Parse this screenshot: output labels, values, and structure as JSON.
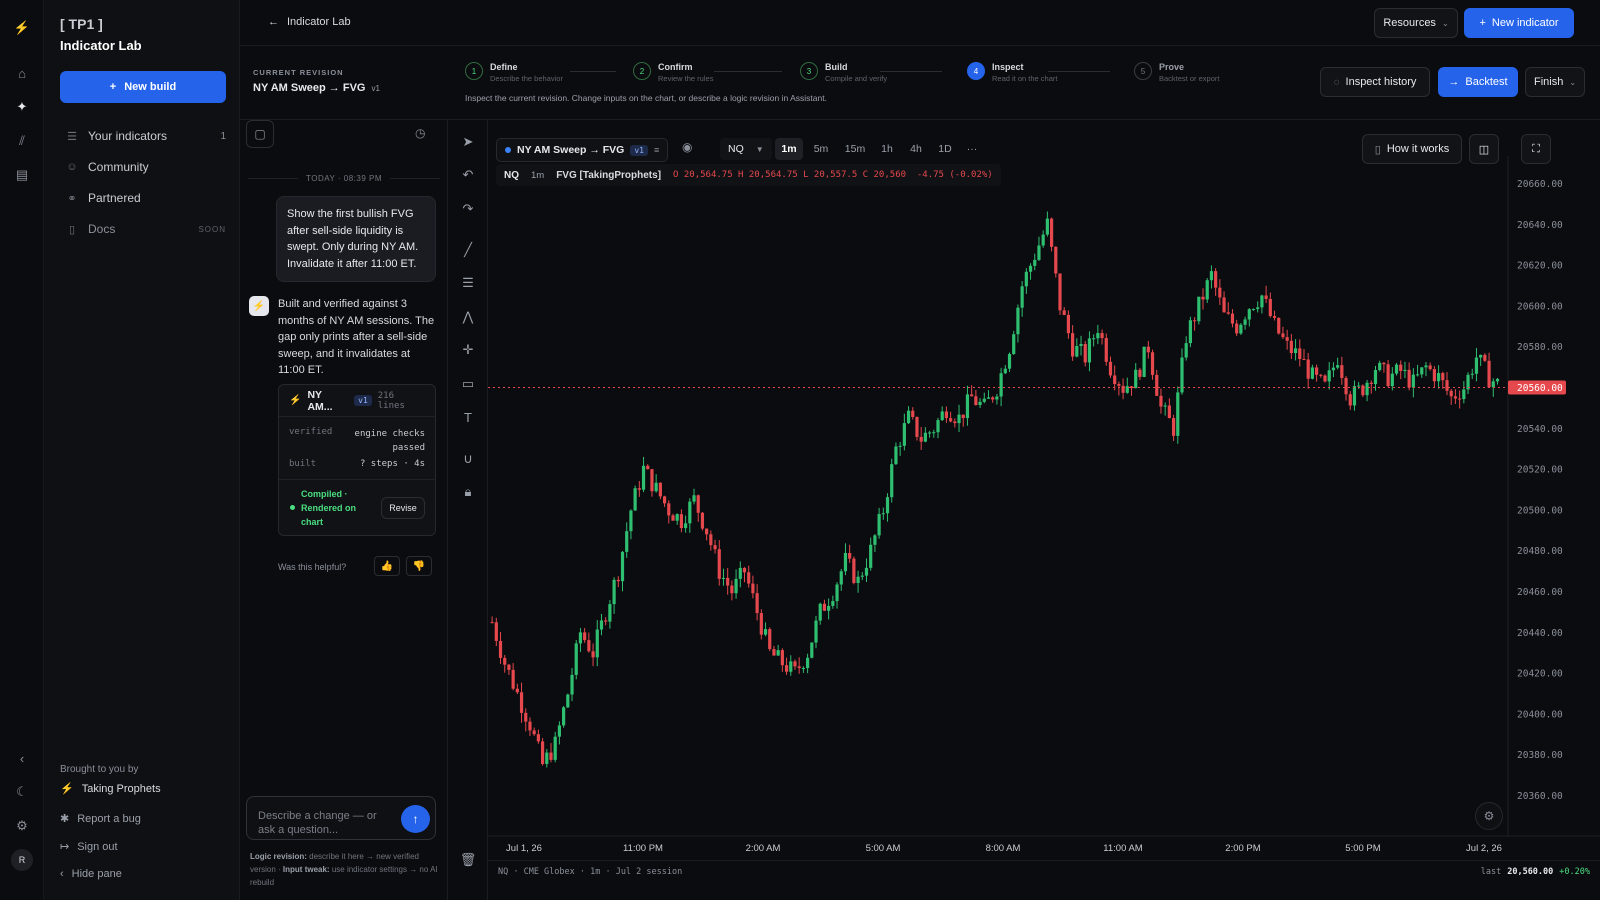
{
  "sidebar": {
    "brand": "[ TP1 ]",
    "app_title": "Indicator Lab",
    "new_build": "New build",
    "items": [
      {
        "label": "Your indicators",
        "count": "1",
        "icon": "list-icon"
      },
      {
        "label": "Community",
        "icon": "users-icon"
      },
      {
        "label": "Partnered",
        "icon": "link-icon"
      },
      {
        "label": "Docs",
        "badge": "SOON",
        "icon": "doc-icon"
      }
    ],
    "brought": "Brought to you by",
    "company": "Taking Prophets",
    "report": "Report a bug",
    "signout": "Sign out",
    "hide": "Hide pane",
    "avatar": "R"
  },
  "topbar": {
    "back_label": "Indicator Lab",
    "resources": "Resources",
    "new_indicator": "New indicator"
  },
  "revision": {
    "caption": "CURRENT REVISION",
    "name": "NY AM Sweep → FVG",
    "version": "v1"
  },
  "steps": [
    {
      "num": "1",
      "title": "Define",
      "sub": "Describe the behavior",
      "state": "done"
    },
    {
      "num": "2",
      "title": "Confirm",
      "sub": "Review the rules",
      "state": "done"
    },
    {
      "num": "3",
      "title": "Build",
      "sub": "Compile and verify",
      "state": "done"
    },
    {
      "num": "4",
      "title": "Inspect",
      "sub": "Read it on the chart",
      "state": "current"
    },
    {
      "num": "5",
      "title": "Prove",
      "sub": "Backtest or export",
      "state": "future"
    }
  ],
  "steps_hint": "Inspect the current revision. Change inputs on the chart, or describe a logic revision in Assistant.",
  "actions": {
    "inspect_history": "Inspect history",
    "backtest": "Backtest",
    "finish": "Finish"
  },
  "chat": {
    "date": "TODAY · 08:39 PM",
    "user_msg": "Show the first bullish FVG after sell-side liquidity is swept. Only during NY AM. Invalidate it after 11:00 ET.",
    "assistant_msg": "Built and verified against 3 months of NY AM sessions. The gap only prints after a sell-side sweep, and it invalidates at 11:00 ET.",
    "card": {
      "title": "NY AM...",
      "version": "v1",
      "lines": "216 lines",
      "verified_k": "verified",
      "verified_v": "engine checks passed",
      "built_k": "built",
      "built_v": "? steps · 4s",
      "status": "Compiled · Rendered on chart",
      "revise": "Revise"
    },
    "helpful": "Was this helpful?",
    "input_placeholder": "Describe a change — or ask a question...",
    "hint_logic_k": "Logic revision:",
    "hint_logic_v": "describe it here → new verified version ·",
    "hint_tweak_k": "Input tweak:",
    "hint_tweak_v": "use indicator settings → no AI rebuild"
  },
  "toolbar": {
    "indicator": "NY AM Sweep → FVG",
    "ind_version": "v1",
    "symbol": "NQ",
    "timeframes": [
      "1m",
      "5m",
      "15m",
      "1h",
      "4h",
      "1D"
    ],
    "active_tf": "1m",
    "how": "How it works"
  },
  "legend": {
    "symbol": "NQ",
    "tf": "1m",
    "study": "FVG [TakingProphets]",
    "ohlc": "O 20,564.75 H 20,564.75 L 20,557.5 C 20,560  -4.75 (-0.02%)"
  },
  "status": {
    "left": "NQ · CME Globex · 1m · Jul 2 session",
    "last_k": "last",
    "last_v": "20,560.00",
    "change": "+0.20%"
  },
  "chart_data": {
    "type": "candlestick",
    "symbol": "NQ",
    "interval": "1m",
    "y_ticks": [
      20660,
      20640,
      20620,
      20600,
      20580,
      20560,
      20540,
      20520,
      20500,
      20480,
      20460,
      20440,
      20420,
      20400,
      20380,
      20360
    ],
    "y_tick_labels": [
      "20660.00",
      "20640.00",
      "20620.00",
      "20600.00",
      "20580.00",
      "20560.00",
      "20540.00",
      "20520.00",
      "20500.00",
      "20480.00",
      "20460.00",
      "20440.00",
      "20420.00",
      "20400.00",
      "20380.00",
      "20360.00"
    ],
    "ylim": [
      20350,
      20676
    ],
    "x_ticks": [
      "Jul 1, 26",
      "11:00 PM",
      "2:00 AM",
      "5:00 AM",
      "8:00 AM",
      "11:00 AM",
      "2:00 PM",
      "5:00 PM",
      "Jul 2, 26"
    ],
    "last_price": 20560,
    "last_price_label": "20560.00",
    "path": [
      [
        0,
        20445
      ],
      [
        3,
        20425
      ],
      [
        6,
        20410
      ],
      [
        9,
        20395
      ],
      [
        12,
        20375
      ],
      [
        15,
        20385
      ],
      [
        18,
        20410
      ],
      [
        21,
        20440
      ],
      [
        24,
        20430
      ],
      [
        27,
        20450
      ],
      [
        30,
        20470
      ],
      [
        33,
        20500
      ],
      [
        36,
        20520
      ],
      [
        39,
        20510
      ],
      [
        42,
        20500
      ],
      [
        45,
        20495
      ],
      [
        48,
        20505
      ],
      [
        51,
        20490
      ],
      [
        54,
        20470
      ],
      [
        57,
        20460
      ],
      [
        60,
        20470
      ],
      [
        63,
        20450
      ],
      [
        66,
        20430
      ],
      [
        69,
        20425
      ],
      [
        72,
        20420
      ],
      [
        75,
        20430
      ],
      [
        78,
        20450
      ],
      [
        81,
        20460
      ],
      [
        84,
        20475
      ],
      [
        87,
        20465
      ],
      [
        90,
        20480
      ],
      [
        93,
        20500
      ],
      [
        96,
        20530
      ],
      [
        99,
        20545
      ],
      [
        102,
        20535
      ],
      [
        105,
        20540
      ],
      [
        108,
        20550
      ],
      [
        111,
        20545
      ],
      [
        114,
        20555
      ],
      [
        117,
        20550
      ],
      [
        120,
        20560
      ],
      [
        123,
        20580
      ],
      [
        126,
        20610
      ],
      [
        129,
        20625
      ],
      [
        132,
        20640
      ],
      [
        135,
        20600
      ],
      [
        138,
        20580
      ],
      [
        141,
        20575
      ],
      [
        144,
        20590
      ],
      [
        147,
        20570
      ],
      [
        150,
        20560
      ],
      [
        153,
        20565
      ],
      [
        156,
        20580
      ],
      [
        159,
        20550
      ],
      [
        162,
        20540
      ],
      [
        165,
        20585
      ],
      [
        168,
        20600
      ],
      [
        171,
        20615
      ],
      [
        174,
        20595
      ],
      [
        177,
        20590
      ],
      [
        180,
        20600
      ],
      [
        183,
        20605
      ],
      [
        186,
        20590
      ],
      [
        189,
        20580
      ],
      [
        192,
        20575
      ],
      [
        195,
        20565
      ],
      [
        198,
        20560
      ],
      [
        201,
        20575
      ],
      [
        204,
        20555
      ],
      [
        207,
        20560
      ],
      [
        210,
        20570
      ],
      [
        213,
        20565
      ],
      [
        216,
        20568
      ],
      [
        219,
        20562
      ],
      [
        222,
        20570
      ],
      [
        225,
        20565
      ],
      [
        228,
        20555
      ],
      [
        231,
        20560
      ],
      [
        234,
        20575
      ],
      [
        237,
        20565
      ],
      [
        240,
        20560
      ]
    ]
  },
  "colors": {
    "up": "#2fbf71",
    "down": "#e5484d",
    "accent": "#2563eb",
    "price_line": "#e5484d"
  }
}
